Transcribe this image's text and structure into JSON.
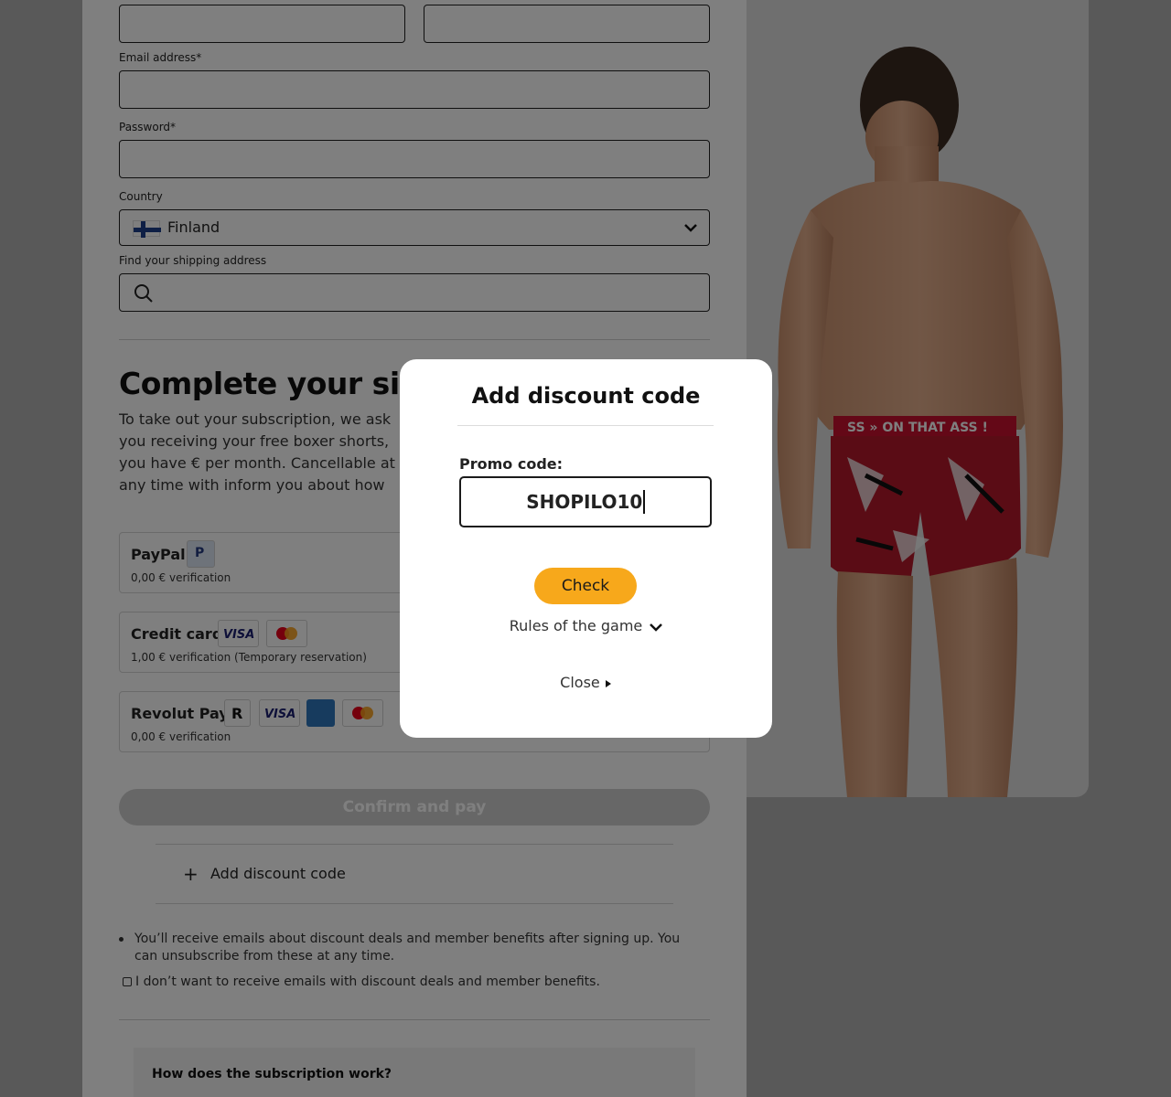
{
  "form": {
    "email_label": "Email address*",
    "password_label": "Password*",
    "country_label": "Country",
    "country_value": "Finland",
    "address_label": "Find your shipping address"
  },
  "subscription": {
    "heading": "Complete your si",
    "paragraph": "To take out your subscription, we ask you receiving your free boxer shorts, you have € per month. Cancellable at any time with inform you about how we process your p"
  },
  "payment_methods": [
    {
      "title": "PayPal",
      "subtitle": "0,00 € verification"
    },
    {
      "title": "Credit card",
      "subtitle": "1,00 € verification (Temporary reservation)"
    },
    {
      "title": "Revolut Pay",
      "subtitle": "0,00 € verification"
    }
  ],
  "confirm_label": "Confirm and pay",
  "add_discount_label": "Add discount code",
  "notice_text": "You’ll receive emails about discount deals and member benefits after signing up. You can unsubscribe from these at any time.",
  "optout_label": "I don’t want to receive emails with discount deals and member benefits.",
  "how_title": "How does the subscription work?",
  "product_band_text": "SS » ON THAT ASS !",
  "modal": {
    "title": "Add discount code",
    "promo_label": "Promo code:",
    "promo_value": "SHOPILO10",
    "check_label": "Check",
    "rules_label": "Rules of the game",
    "close_label": "Close"
  },
  "icons": {
    "country_flag": "finland-flag-icon",
    "search": "search-icon",
    "dropdown": "chevron-down-icon"
  },
  "colors": {
    "accent": "#f7a81b",
    "overlay": "rgba(0,0,0,0.5)"
  }
}
